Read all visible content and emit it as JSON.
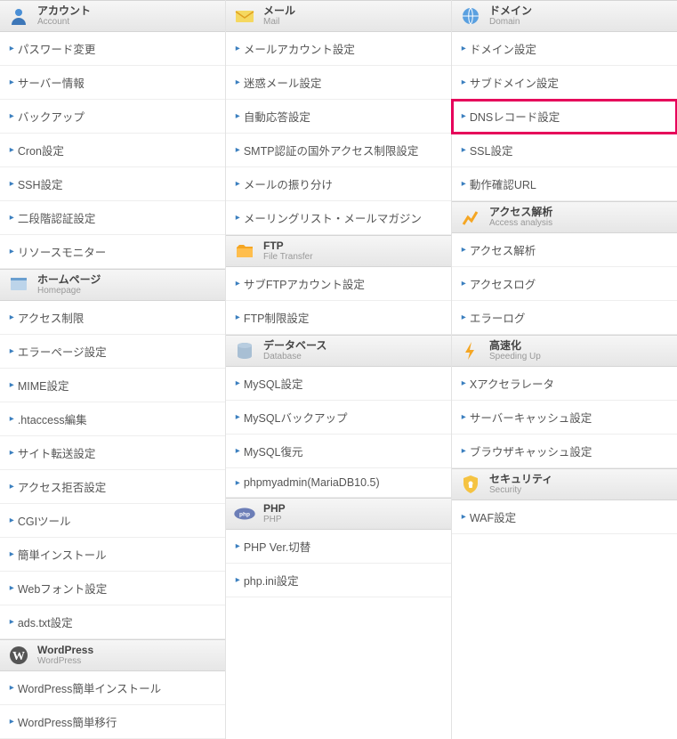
{
  "columns": [
    {
      "sections": [
        {
          "icon": "account-icon",
          "title_ja": "アカウント",
          "title_en": "Account",
          "items": [
            "パスワード変更",
            "サーバー情報",
            "バックアップ",
            "Cron設定",
            "SSH設定",
            "二段階認証設定",
            "リソースモニター"
          ]
        },
        {
          "icon": "homepage-icon",
          "title_ja": "ホームページ",
          "title_en": "Homepage",
          "items": [
            "アクセス制限",
            "エラーページ設定",
            "MIME設定",
            ".htaccess編集",
            "サイト転送設定",
            "アクセス拒否設定",
            "CGIツール",
            "簡単インストール",
            "Webフォント設定",
            "ads.txt設定"
          ]
        },
        {
          "icon": "wordpress-icon",
          "title_ja": "WordPress",
          "title_en": "WordPress",
          "items": [
            "WordPress簡単インストール",
            "WordPress簡単移行"
          ]
        }
      ]
    },
    {
      "sections": [
        {
          "icon": "mail-icon",
          "title_ja": "メール",
          "title_en": "Mail",
          "items": [
            "メールアカウント設定",
            "迷惑メール設定",
            "自動応答設定",
            "SMTP認証の国外アクセス制限設定",
            "メールの振り分け",
            "メーリングリスト・メールマガジン"
          ]
        },
        {
          "icon": "ftp-icon",
          "title_ja": "FTP",
          "title_en": "File Transfer",
          "items": [
            "サブFTPアカウント設定",
            "FTP制限設定"
          ]
        },
        {
          "icon": "database-icon",
          "title_ja": "データベース",
          "title_en": "Database",
          "items": [
            "MySQL設定",
            "MySQLバックアップ",
            "MySQL復元",
            "phpmyadmin(MariaDB10.5)"
          ]
        },
        {
          "icon": "php-icon",
          "title_ja": "PHP",
          "title_en": "PHP",
          "items": [
            "PHP Ver.切替",
            "php.ini設定"
          ]
        }
      ]
    },
    {
      "sections": [
        {
          "icon": "domain-icon",
          "title_ja": "ドメイン",
          "title_en": "Domain",
          "items": [
            "ドメイン設定",
            "サブドメイン設定",
            "DNSレコード設定",
            "SSL設定",
            "動作確認URL"
          ],
          "highlight_index": 2
        },
        {
          "icon": "access-icon",
          "title_ja": "アクセス解析",
          "title_en": "Access analysis",
          "items": [
            "アクセス解析",
            "アクセスログ",
            "エラーログ"
          ]
        },
        {
          "icon": "speed-icon",
          "title_ja": "高速化",
          "title_en": "Speeding Up",
          "items": [
            "Xアクセラレータ",
            "サーバーキャッシュ設定",
            "ブラウザキャッシュ設定"
          ]
        },
        {
          "icon": "security-icon",
          "title_ja": "セキュリティ",
          "title_en": "Security",
          "items": [
            "WAF設定"
          ]
        }
      ]
    }
  ]
}
